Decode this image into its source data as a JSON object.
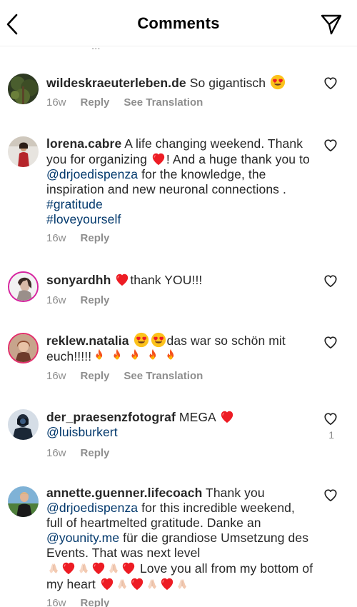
{
  "header": {
    "title": "Comments",
    "back_icon": "chevron-left-icon",
    "send_icon": "send-icon"
  },
  "peek_text": "...",
  "comments": [
    {
      "username": "wildeskraeuterleben.de",
      "text": " So gigantisch ",
      "time": "16w",
      "reply": "Reply",
      "see_translation": "See Translation"
    },
    {
      "username": "lorena.cabre",
      "text_1": " A life changing weekend. Thank you for organizing ",
      "text_2": "! And a huge thank you to ",
      "mention": "@drjoedispenza",
      "text_3": " for the knowledge, the inspiration and new neuronal  connections . ",
      "hashtag_1": "#gratitude",
      "hashtag_2": "#loveyourself",
      "time": "16w",
      "reply": "Reply"
    },
    {
      "username": "sonyardhh",
      "text": "thank YOU!!!",
      "time": "16w",
      "reply": "Reply"
    },
    {
      "username": "reklew.natalia",
      "text": "das war so schön mit euch!!!!!",
      "time": "16w",
      "reply": "Reply",
      "see_translation": "See Translation"
    },
    {
      "username": "der_praesenzfotograf",
      "text": " MEGA ",
      "mention": "@luisburkert",
      "time": "16w",
      "reply": "Reply",
      "like_count": "1"
    },
    {
      "username": "annette.guenner.lifecoach",
      "text_1": " Thank you ",
      "mention_1": "@drjoedispenza",
      "text_2": " for this incredible weekend, full of heartmelted gratitude. Danke an ",
      "mention_2": "@younity.me",
      "text_3": " für die grandiose Umsetzung des Events. That was next level ",
      "text_4": " Love you all from my bottom of my heart ",
      "time": "16w",
      "reply": "Reply"
    }
  ],
  "colors": {
    "text": "#262626",
    "meta": "#8e8e8e",
    "link": "#00376b",
    "heart_red": "#ed1c24",
    "story_ring": "#d6249f"
  }
}
